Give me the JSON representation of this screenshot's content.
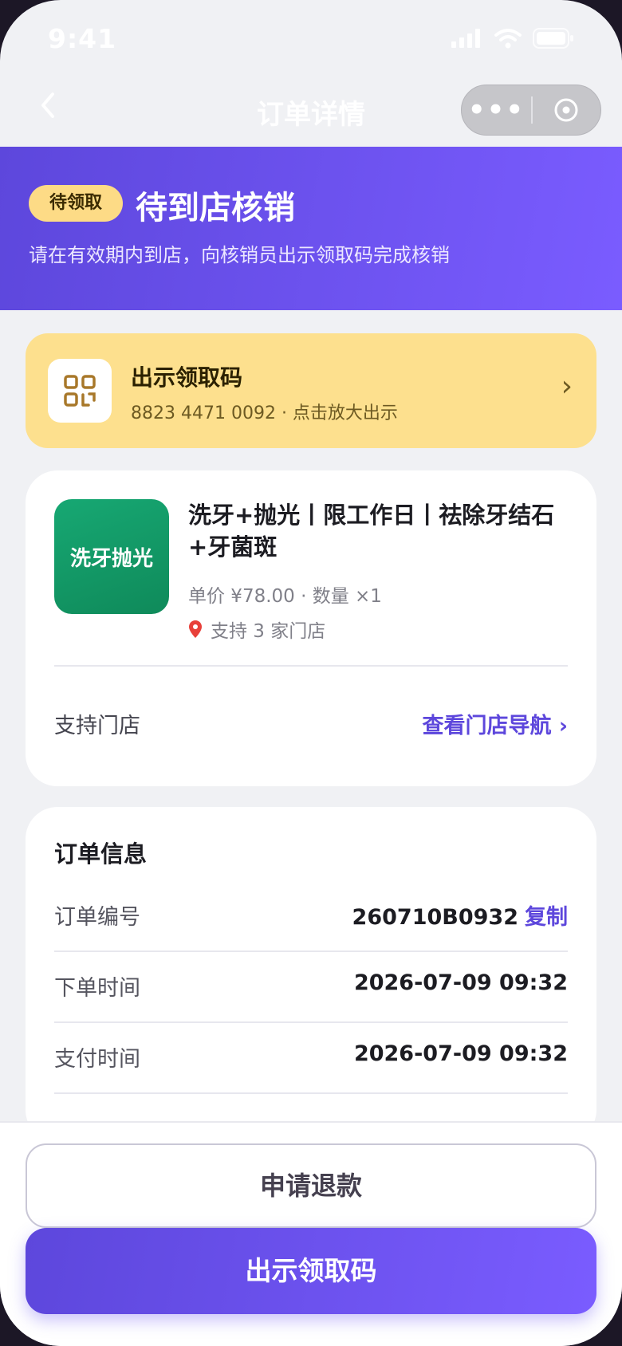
{
  "status_bar": {
    "time": "9:41"
  },
  "nav": {
    "title": "订单详情",
    "more_glyph": "•••"
  },
  "hero": {
    "badge": "待领取",
    "title": "待到店核销",
    "subtitle": "请在有效期内到店，向核销员出示领取码完成核销"
  },
  "code_card": {
    "title": "出示领取码",
    "code_line": "8823 4471 0092 · 点击放大出示",
    "icon": "qr-code-icon"
  },
  "product": {
    "thumb_label": "洗牙抛光",
    "name": "洗牙+抛光丨限工作日丨祛除牙结石+牙菌斑",
    "price_line": "单价 ¥78.00 · 数量 ×1",
    "store_line": "支持 3 家门店",
    "store_label": "支持门店",
    "store_link": "查看门店导航 ›"
  },
  "order_info": {
    "title": "订单信息",
    "rows": [
      {
        "label": "订单编号",
        "value": "260710B0932",
        "action": "复制"
      },
      {
        "label": "下单时间",
        "value": "2026-07-09 09:32"
      },
      {
        "label": "支付时间",
        "value": "2026-07-09 09:32"
      }
    ]
  },
  "buttons": {
    "refund": "申请退款",
    "show_code": "出示领取码"
  },
  "colors": {
    "primary": "#5d47dc",
    "accent_yellow": "#fde08e",
    "green": "#17a873"
  }
}
